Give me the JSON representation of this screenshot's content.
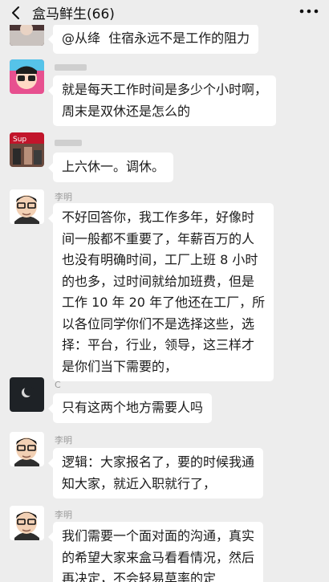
{
  "header": {
    "title": "盒马鲜生(66)"
  },
  "messages": [
    {
      "sender": "",
      "text": "@从绛  住宿永远不是工作的阻力"
    },
    {
      "sender": "",
      "text": "就是每天工作时间是多少个小时啊，\n周末是双休还是怎么的"
    },
    {
      "sender": "",
      "text": "上六休一。调休。"
    },
    {
      "sender": "李明",
      "text": "不好回答你，我工作多年，好像时\n间一般都不重要了，年薪百万的人\n也没有明确时间，工厂上班 8 小时\n的也多，过时间就给加班费，但是\n工作 10 年 20 年了他还在工厂，所\n以各位同学你们不是选择这些，选\n择：平台，行业，领导，这三样才\n是你们当下需要的，"
    },
    {
      "sender": "C",
      "text": "只有这两个地方需要人吗"
    },
    {
      "sender": "李明",
      "text": "逻辑：大家报名了，要的时候我通\n知大家，就近入职就行了，"
    },
    {
      "sender": "李明",
      "text": "我们需要一个面对面的沟通，真实\n的希望大家来盒马看看情况，然后\n再决定，不会轻易草率的定"
    }
  ]
}
